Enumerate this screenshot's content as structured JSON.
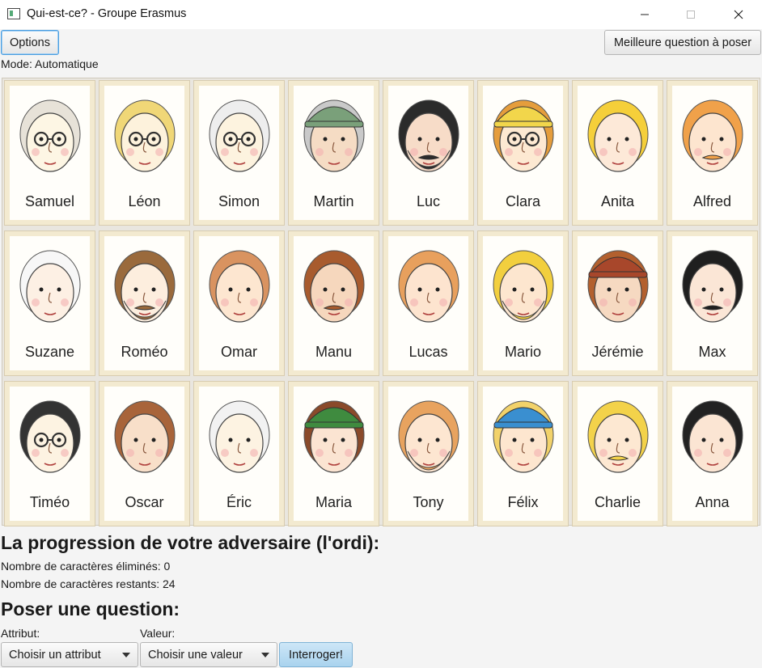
{
  "window": {
    "title": "Qui-est-ce? - Groupe Erasmus",
    "minimize_icon": "minimize-icon",
    "maximize_icon": "maximize-icon",
    "close_icon": "close-icon"
  },
  "toolbar": {
    "options_label": "Options",
    "best_question_label": "Meilleure question à poser",
    "mode_text": "Mode: Automatique"
  },
  "board": {
    "characters": [
      {
        "name": "Samuel",
        "hair": "#e7e2d8",
        "skin": "#fdf6e4",
        "glasses": true,
        "beard": false,
        "mustache": false,
        "hat": null
      },
      {
        "name": "Léon",
        "hair": "#f0d777",
        "skin": "#fdf2dc",
        "glasses": true,
        "beard": false,
        "mustache": false,
        "hat": null
      },
      {
        "name": "Simon",
        "hair": "#eeeeee",
        "skin": "#fdf3df",
        "glasses": true,
        "beard": false,
        "mustache": false,
        "hat": null
      },
      {
        "name": "Martin",
        "hair": "#c9c9c9",
        "skin": "#f5dcc4",
        "glasses": false,
        "beard": false,
        "mustache": false,
        "hat": "#7aa07a"
      },
      {
        "name": "Luc",
        "hair": "#2b2b2b",
        "skin": "#f7dcc8",
        "glasses": false,
        "beard": true,
        "mustache": true,
        "hat": null
      },
      {
        "name": "Clara",
        "hair": "#e59d3c",
        "skin": "#fde9d2",
        "glasses": true,
        "beard": false,
        "mustache": false,
        "hat": "#f2d64b"
      },
      {
        "name": "Anita",
        "hair": "#f5cf3a",
        "skin": "#fde9d8",
        "glasses": false,
        "beard": false,
        "mustache": false,
        "hat": null
      },
      {
        "name": "Alfred",
        "hair": "#f0a14a",
        "skin": "#fde5cf",
        "glasses": false,
        "beard": false,
        "mustache": true,
        "hat": null
      },
      {
        "name": "Suzane",
        "hair": "#f7f7f7",
        "skin": "#fdf0e4",
        "glasses": false,
        "beard": false,
        "mustache": false,
        "hat": null
      },
      {
        "name": "Roméo",
        "hair": "#9a6a3c",
        "skin": "#fdeede",
        "glasses": false,
        "beard": true,
        "mustache": true,
        "hat": null
      },
      {
        "name": "Omar",
        "hair": "#d99360",
        "skin": "#fde6d0",
        "glasses": false,
        "beard": false,
        "mustache": false,
        "hat": null
      },
      {
        "name": "Manu",
        "hair": "#a85b2e",
        "skin": "#f6d7bd",
        "glasses": false,
        "beard": false,
        "mustache": true,
        "hat": null
      },
      {
        "name": "Lucas",
        "hair": "#e8a05d",
        "skin": "#fde4cf",
        "glasses": false,
        "beard": false,
        "mustache": false,
        "hat": null
      },
      {
        "name": "Mario",
        "hair": "#f2cf3e",
        "skin": "#fde6cf",
        "glasses": false,
        "beard": true,
        "mustache": false,
        "hat": null
      },
      {
        "name": "Jérémie",
        "hair": "#b3602e",
        "skin": "#f6d9c1",
        "glasses": false,
        "beard": false,
        "mustache": false,
        "hat": "#a8472b"
      },
      {
        "name": "Max",
        "hair": "#1f1f1f",
        "skin": "#fbe6d6",
        "glasses": false,
        "beard": false,
        "mustache": true,
        "hat": null
      },
      {
        "name": "Timéo",
        "hair": "#333333",
        "skin": "#fdf3e2",
        "glasses": true,
        "beard": false,
        "mustache": false,
        "hat": null
      },
      {
        "name": "Oscar",
        "hair": "#a8643a",
        "skin": "#f8dfc9",
        "glasses": false,
        "beard": false,
        "mustache": false,
        "hat": null
      },
      {
        "name": "Éric",
        "hair": "#f2f2f2",
        "skin": "#fdf3e2",
        "glasses": false,
        "beard": false,
        "mustache": false,
        "hat": null
      },
      {
        "name": "Maria",
        "hair": "#8a4a2a",
        "skin": "#fbe4d2",
        "glasses": false,
        "beard": false,
        "mustache": false,
        "hat": "#3f8b3f"
      },
      {
        "name": "Tony",
        "hair": "#e8a35f",
        "skin": "#fde6d1",
        "glasses": false,
        "beard": true,
        "mustache": false,
        "hat": null
      },
      {
        "name": "Félix",
        "hair": "#f2d26a",
        "skin": "#fde6cf",
        "glasses": false,
        "beard": false,
        "mustache": false,
        "hat": "#3a8fd0"
      },
      {
        "name": "Charlie",
        "hair": "#f3d24a",
        "skin": "#fde8d2",
        "glasses": false,
        "beard": false,
        "mustache": true,
        "hat": null
      },
      {
        "name": "Anna",
        "hair": "#222222",
        "skin": "#fbe5d3",
        "glasses": false,
        "beard": false,
        "mustache": false,
        "hat": null
      }
    ]
  },
  "progress": {
    "heading": "La progression de votre adversaire (l'ordi):",
    "eliminated": "Nombre de caractères éliminés: 0",
    "remaining": "Nombre de caractères restants: 24"
  },
  "question": {
    "heading": "Poser une question:",
    "attribute_label": "Attribut:",
    "value_label": "Valeur:",
    "attribute_selected": "Choisir un attribut",
    "value_selected": "Choisir une valeur",
    "ask_label": "Interroger!"
  }
}
